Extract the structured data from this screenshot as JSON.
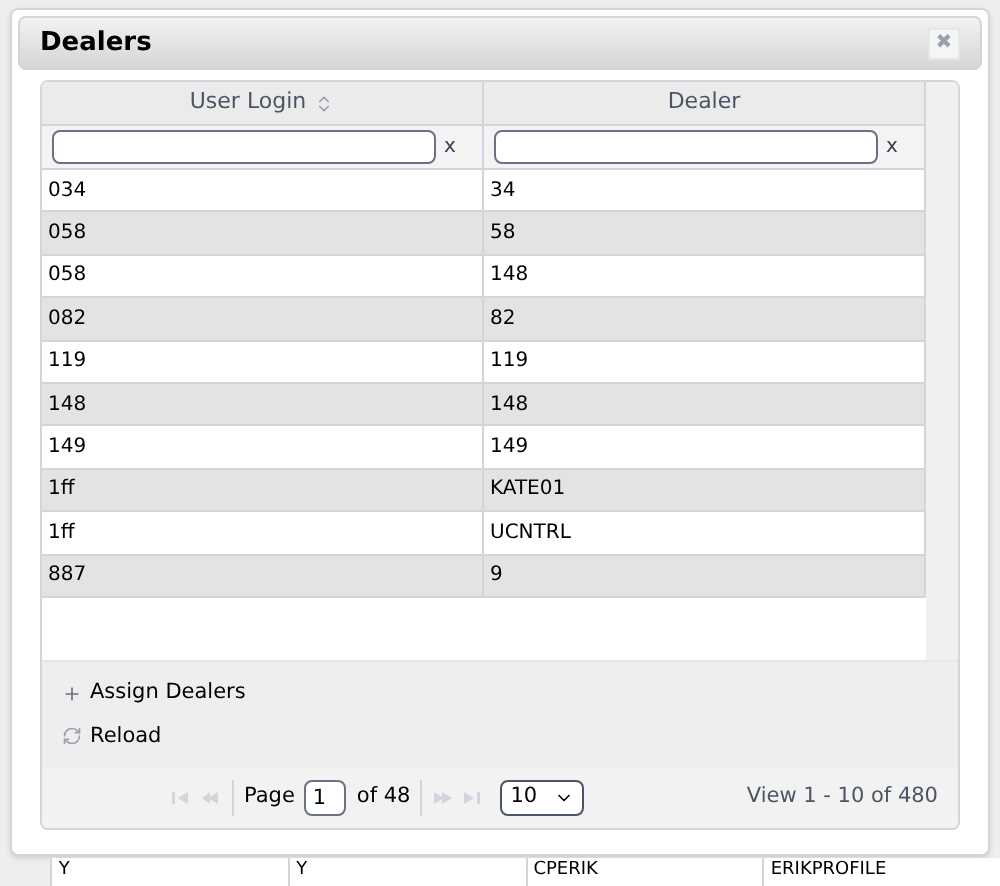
{
  "dialog": {
    "title": "Dealers",
    "close": "✖"
  },
  "table": {
    "columns": [
      {
        "label": "User Login",
        "sortable": true
      },
      {
        "label": "Dealer",
        "sortable": false
      }
    ],
    "filter_clear": [
      "x",
      "x"
    ],
    "rows": [
      {
        "cells": [
          "034",
          "34"
        ]
      },
      {
        "cells": [
          "058",
          "58"
        ]
      },
      {
        "cells": [
          "058",
          "148"
        ]
      },
      {
        "cells": [
          "082",
          "82"
        ]
      },
      {
        "cells": [
          "119",
          "119"
        ]
      },
      {
        "cells": [
          "148",
          "148"
        ]
      },
      {
        "cells": [
          "149",
          "149"
        ]
      },
      {
        "cells": [
          "1ff",
          "KATE01"
        ]
      },
      {
        "cells": [
          "1ff",
          "UCNTRL"
        ]
      },
      {
        "cells": [
          "887",
          "9"
        ]
      }
    ]
  },
  "actions": [
    {
      "kind": "add",
      "label": "Assign Dealers"
    },
    {
      "kind": "reload",
      "label": "Reload"
    }
  ],
  "pager": {
    "page_label": "Page",
    "page": "1",
    "of_label": "of 48",
    "page_size": "10",
    "summary": "View 1 - 10 of 480"
  },
  "background_row": [
    "Y",
    "Y",
    "CPERIK",
    "ERIKPROFILE"
  ]
}
